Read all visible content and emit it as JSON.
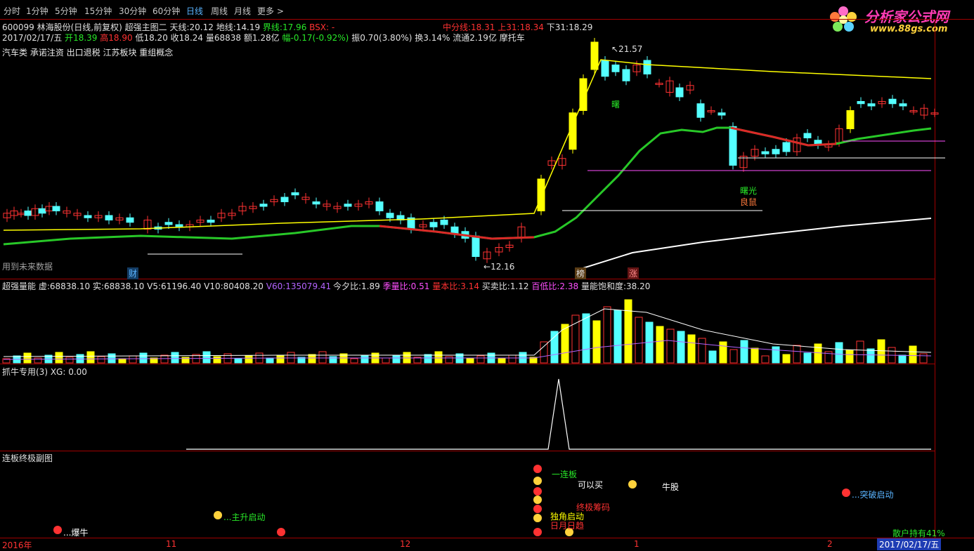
{
  "toolbar": {
    "items": [
      "分时",
      "1分钟",
      "5分钟",
      "15分钟",
      "30分钟",
      "60分钟",
      "日线",
      "周线",
      "月线",
      "更多 >"
    ],
    "active_index": 6
  },
  "logo": {
    "title": "分析家公式网",
    "url": "www.88gs.com"
  },
  "header": {
    "line1": {
      "stock": "600099 林海股份(日线,前复权) 超强主图二",
      "tianxian_label": "天线:",
      "tianxian": "20.12",
      "dixian_label": "地线:",
      "dixian": "14.19",
      "jiexian_label": "界线:",
      "jiexian": "17.96",
      "bsx": "BSX: -",
      "zhongfen_label": "中分线:",
      "zhongfen": "18.31",
      "shang31_label": "上31:",
      "shang31": "18.34",
      "xia31_label": "下31:",
      "xia31": "18.29"
    },
    "line2": {
      "date": "2017/02/17/五",
      "open_label": "开",
      "open": "18.39",
      "high_label": "高",
      "high": "18.90",
      "low_label": "低",
      "low": "18.20",
      "close_label": "收",
      "close": "18.24",
      "vol_label": "量",
      "vol": "68838",
      "amount_label": "额",
      "amount": "1.28亿",
      "change_label": "幅",
      "change": "-0.17(-0.92%)",
      "amp_label": "振",
      "amp": "0.70(3.80%)",
      "turnover_label": "换",
      "turnover": "3.14%",
      "float_label": "流通",
      "float": "2.19亿",
      "concept": "摩托车"
    },
    "line3": "汽车类 承诺注资 出口退税 江苏板块 重组概念"
  },
  "main_chart": {
    "annot_high": "21.57",
    "annot_low": "12.16",
    "future_data": "用到未来数据",
    "marker_cai": "财",
    "marker_bang": "榜",
    "marker_zhang": "涨",
    "label_shuguang": "曙光",
    "label_liangji": "良鼠",
    "label_shu": "曙"
  },
  "volume_panel": {
    "title": "超强量能",
    "xu_label": "虚:",
    "xu": "68838.10",
    "shi_label": "实:",
    "shi": "68838.10",
    "v5_label": "V5:",
    "v5": "61196.40",
    "v10_label": "V10:",
    "v10": "80408.20",
    "v60_label": "V60:",
    "v60": "135079.41",
    "jinxi_label": "今夕比:",
    "jinxi": "1.89",
    "jiliang_label": "季量比:",
    "jiliang": "0.51",
    "liangben_label": "量本比:",
    "liangben": "3.14",
    "maimai_label": "买卖比:",
    "maimai": "1.12",
    "baidi_label": "百低比:",
    "baidi": "2.38",
    "baohe_label": "量能饱和度:",
    "baohe": "38.20"
  },
  "zhuaniu_panel": {
    "title": "抓牛专用(3) XG: 0.00"
  },
  "lianban_panel": {
    "title": "连板终极副图",
    "labels": {
      "baoniu": "...爆牛",
      "zhusheng": "...主升启动",
      "niugu": "牛股",
      "tupo": "...突破启动",
      "yilianban": "一连板",
      "keyimai": "可以买",
      "zhongji": "终极筹码",
      "dujiao": "独角启动",
      "rimu": "日月日趋"
    },
    "sanhu": "散户持有41%"
  },
  "xaxis": {
    "labels": [
      "2016年",
      "11",
      "12",
      "1",
      "2"
    ],
    "current_date": "2017/02/17/五"
  },
  "colors": {
    "up": "#ff3232",
    "down": "#54ffff",
    "yellow": "#ffff00",
    "green": "#28c828",
    "border": "#a00000",
    "magenta": "#ff50ff"
  }
}
